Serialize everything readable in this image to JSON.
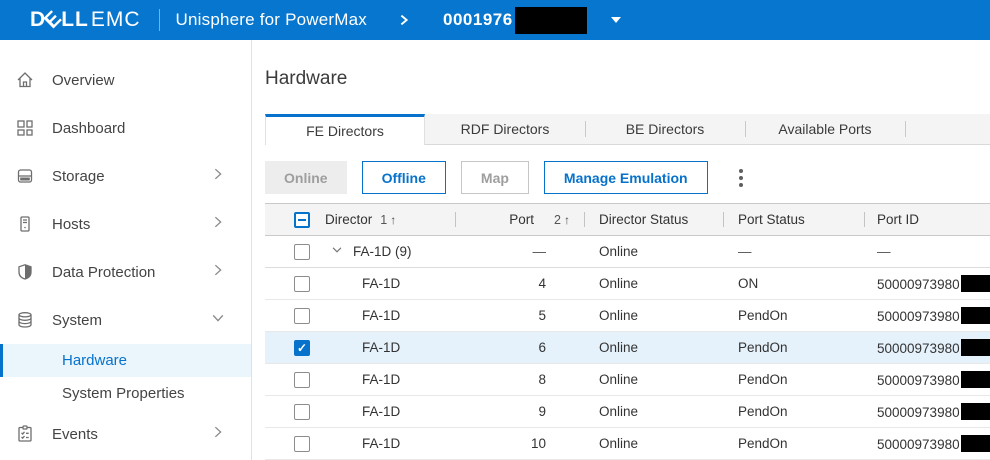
{
  "header": {
    "brand_dell_d": "D",
    "brand_dell_e": "E",
    "brand_dell_ll": "LL",
    "brand_emc": "EMC",
    "product": "Unisphere for PowerMax",
    "array_id": "0001976",
    "array_id_redacted": true,
    "accent_blue": "#0776CE"
  },
  "sidebar": {
    "items": [
      {
        "label": "Overview",
        "icon": "home-icon"
      },
      {
        "label": "Dashboard",
        "icon": "dashboard-icon"
      },
      {
        "label": "Storage",
        "icon": "storage-icon",
        "chevron": "right"
      },
      {
        "label": "Hosts",
        "icon": "hosts-icon",
        "chevron": "right"
      },
      {
        "label": "Data Protection",
        "icon": "shield-icon",
        "chevron": "right"
      },
      {
        "label": "System",
        "icon": "system-icon",
        "chevron": "down",
        "expanded": true
      },
      {
        "label": "Hardware",
        "child": true,
        "active": true
      },
      {
        "label": "System Properties",
        "child": true
      },
      {
        "label": "Events",
        "icon": "events-icon",
        "chevron": "right"
      }
    ],
    "selected_color": "#0672CB"
  },
  "main": {
    "title": "Hardware",
    "tabs": [
      {
        "label": "FE Directors",
        "active": true
      },
      {
        "label": "RDF Directors",
        "active": false
      },
      {
        "label": "BE Directors",
        "active": false
      },
      {
        "label": "Available Ports",
        "active": false
      }
    ],
    "toolbar": {
      "online_label": "Online",
      "offline_label": "Offline",
      "map_label": "Map",
      "manage_emulation_label": "Manage Emulation",
      "kebab_icon": "more-options-icon"
    },
    "table": {
      "columns": {
        "director": "Director",
        "port": "Port",
        "director_status": "Director Status",
        "port_status": "Port Status",
        "port_id": "Port ID"
      },
      "sort": {
        "director_order": "1",
        "director_arrow": "↑",
        "port_order": "2",
        "port_arrow": "↑"
      },
      "header_checkbox_state": "indeterminate",
      "rows": [
        {
          "type": "group",
          "expanded": true,
          "director": "FA-1D (9)",
          "port": "—",
          "director_status": "Online",
          "port_status": "—",
          "port_id": "—",
          "checked": false
        },
        {
          "type": "port",
          "director": "FA-1D",
          "port": "4",
          "director_status": "Online",
          "port_status": "ON",
          "port_id": "50000973980",
          "port_id_redacted": true,
          "checked": false
        },
        {
          "type": "port",
          "director": "FA-1D",
          "port": "5",
          "director_status": "Online",
          "port_status": "PendOn",
          "port_id": "50000973980",
          "port_id_redacted": true,
          "checked": false
        },
        {
          "type": "port",
          "director": "FA-1D",
          "port": "6",
          "director_status": "Online",
          "port_status": "PendOn",
          "port_id": "50000973980",
          "port_id_redacted": true,
          "checked": true,
          "selected": true
        },
        {
          "type": "port",
          "director": "FA-1D",
          "port": "8",
          "director_status": "Online",
          "port_status": "PendOn",
          "port_id": "50000973980",
          "port_id_redacted": true,
          "checked": false
        },
        {
          "type": "port",
          "director": "FA-1D",
          "port": "9",
          "director_status": "Online",
          "port_status": "PendOn",
          "port_id": "50000973980",
          "port_id_redacted": true,
          "checked": false
        },
        {
          "type": "port",
          "director": "FA-1D",
          "port": "10",
          "director_status": "Online",
          "port_status": "PendOn",
          "port_id": "50000973980",
          "port_id_redacted": true,
          "checked": false
        }
      ]
    }
  }
}
